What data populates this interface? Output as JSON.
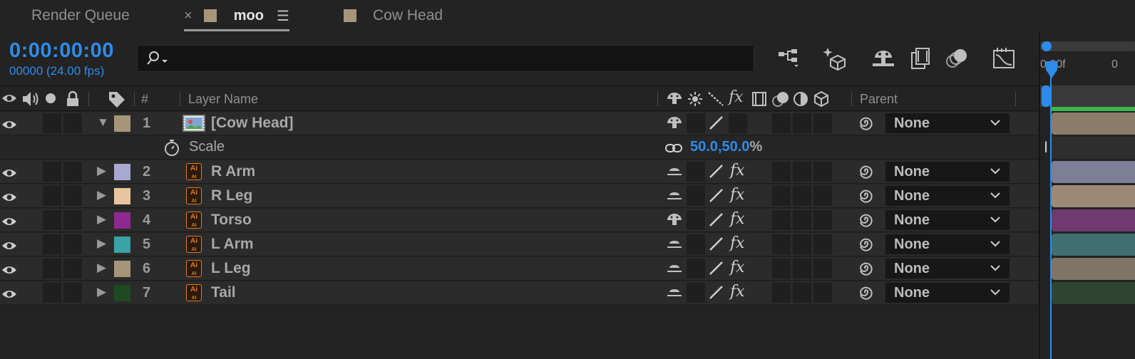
{
  "tabs": [
    {
      "label": "Render Queue"
    },
    {
      "label": "moo",
      "color": "#a7957a",
      "active": true
    },
    {
      "label": "Cow Head",
      "color": "#a7957a"
    }
  ],
  "toolbar": {
    "timecode": "0:00:00:00",
    "fps_label": "00000 (24.00 fps)",
    "search_value": ""
  },
  "ruler": {
    "label_0": "0:00f",
    "label_1": "0"
  },
  "header": {
    "number": "#",
    "layer_name": "Layer Name",
    "parent": "Parent"
  },
  "scale_property": {
    "name": "Scale",
    "x": "50.0",
    "comma": ",",
    "y": "50.0",
    "unit": "%"
  },
  "layers": [
    {
      "num": "1",
      "name": "[Cow Head]",
      "color": "#a7957a",
      "type": "precomp",
      "expanded": true,
      "parent": "None"
    },
    {
      "num": "2",
      "name": "R Arm",
      "color": "#a8a9d0",
      "type": "illustrator",
      "parent": "None"
    },
    {
      "num": "3",
      "name": "R Leg",
      "color": "#e7c59e",
      "type": "illustrator",
      "parent": "None"
    },
    {
      "num": "4",
      "name": "Torso",
      "color": "#8e2a8f",
      "type": "illustrator",
      "parent": "None"
    },
    {
      "num": "5",
      "name": "L Arm",
      "color": "#3aa1a4",
      "type": "illustrator",
      "parent": "None"
    },
    {
      "num": "6",
      "name": "L Leg",
      "color": "#a7957a",
      "type": "illustrator",
      "parent": "None"
    },
    {
      "num": "7",
      "name": "Tail",
      "color": "#1e4a22",
      "type": "illustrator",
      "parent": "None"
    }
  ],
  "track_colors": [
    "#8c7d6a",
    "#7d7f96",
    "#9c8a76",
    "#6e3a70",
    "#3f6f70",
    "#7f7564",
    "#2f4532"
  ],
  "accent": "#2d8ceb"
}
